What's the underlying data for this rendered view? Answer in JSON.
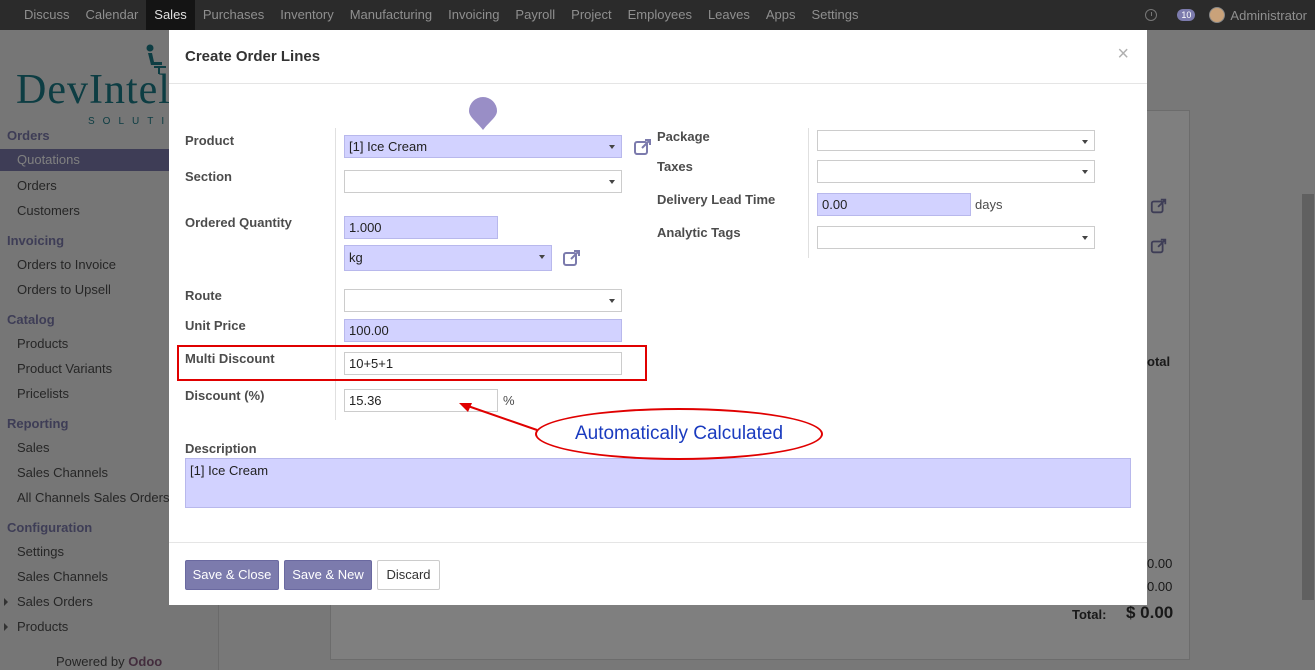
{
  "topbar": {
    "menu": [
      "Discuss",
      "Calendar",
      "Sales",
      "Purchases",
      "Inventory",
      "Manufacturing",
      "Invoicing",
      "Payroll",
      "Project",
      "Employees",
      "Leaves",
      "Apps",
      "Settings"
    ],
    "active_menu": "Sales",
    "chat_count": "10",
    "user": "Administrator"
  },
  "sidebar": {
    "logo_main": "DevIntel",
    "logo_sub": "SOLUTIONS",
    "sections": [
      {
        "title": "Orders",
        "items": [
          "Quotations",
          "Orders",
          "Customers"
        ]
      },
      {
        "title": "Invoicing",
        "items": [
          "Orders to Invoice",
          "Orders to Upsell"
        ]
      },
      {
        "title": "Catalog",
        "items": [
          "Products",
          "Product Variants",
          "Pricelists"
        ]
      },
      {
        "title": "Reporting",
        "items": [
          "Sales",
          "Sales Channels",
          "All Channels Sales Orders"
        ]
      },
      {
        "title": "Configuration",
        "items": [
          "Settings",
          "Sales Channels",
          "Sales Orders",
          "Products"
        ]
      }
    ],
    "active_item": "Quotations",
    "powered_prefix": "Powered by",
    "powered_brand": "Odoo"
  },
  "background": {
    "col_total": "otal",
    "amount_1": "0.00",
    "amount_2": "0.00",
    "total_label": "Total:",
    "total_value": "$ 0.00"
  },
  "modal": {
    "title": "Create Order Lines",
    "close_glyph": "×",
    "left_fields": {
      "product_label": "Product",
      "product_value": "[1] Ice Cream",
      "section_label": "Section",
      "section_value": "",
      "qty_label": "Ordered Quantity",
      "qty_value": "1.000",
      "uom_value": "kg",
      "route_label": "Route",
      "route_value": "",
      "price_label": "Unit Price",
      "price_value": "100.00",
      "multi_discount_label": "Multi Discount",
      "multi_discount_value": "10+5+1",
      "discount_label": "Discount (%)",
      "discount_value": "15.36",
      "discount_suffix": "%"
    },
    "right_fields": {
      "package_label": "Package",
      "package_value": "",
      "taxes_label": "Taxes",
      "taxes_value": "",
      "lead_time_label": "Delivery Lead Time",
      "lead_time_value": "0.00",
      "lead_time_suffix": "days",
      "analytic_label": "Analytic Tags",
      "analytic_value": ""
    },
    "description_label": "Description",
    "description_value": "[1] Ice Cream",
    "buttons": {
      "save_close": "Save & Close",
      "save_new": "Save & New",
      "discard": "Discard"
    }
  },
  "annotation": {
    "callout_text": "Automatically Calculated"
  },
  "colors": {
    "brand": "#7c7bad",
    "required_field": "#d2d2ff",
    "annotation_red": "#e00000",
    "annotation_text": "#1a3bbf"
  }
}
